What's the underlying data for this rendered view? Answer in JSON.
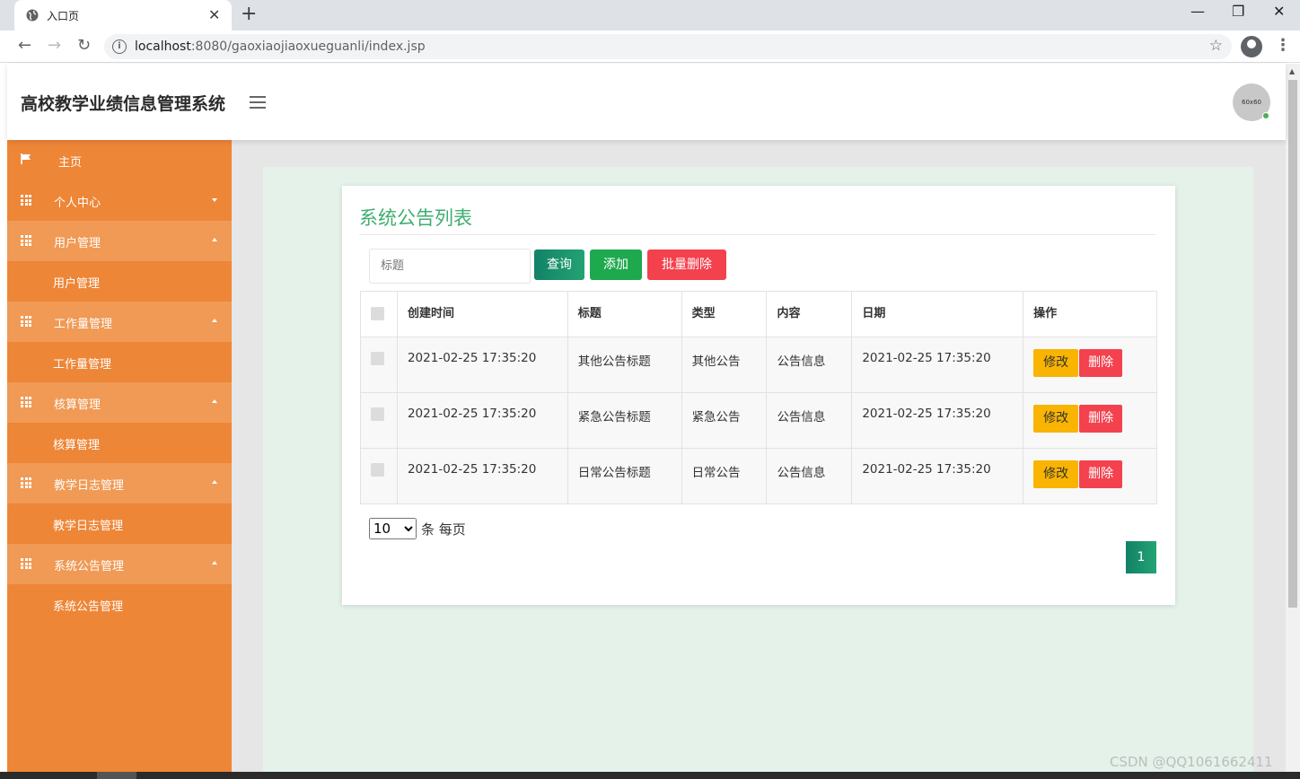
{
  "browser": {
    "tab_title": "入口页",
    "url_host": "localhost",
    "url_rest": ":8080/gaoxiaojiaoxueguanli/index.jsp"
  },
  "header": {
    "title": "高校教学业绩信息管理系统",
    "avatar_text": "60x60"
  },
  "sidebar": {
    "items": [
      {
        "label": "主页",
        "icon": "flag-icon"
      },
      {
        "label": "个人中心",
        "icon": "grid-icon"
      },
      {
        "label": "用户管理",
        "icon": "grid-icon"
      },
      {
        "label": "用户管理"
      },
      {
        "label": "工作量管理",
        "icon": "grid-icon"
      },
      {
        "label": "工作量管理"
      },
      {
        "label": "核算管理",
        "icon": "grid-icon"
      },
      {
        "label": "核算管理"
      },
      {
        "label": "教学日志管理",
        "icon": "grid-icon"
      },
      {
        "label": "教学日志管理"
      },
      {
        "label": "系统公告管理",
        "icon": "grid-icon"
      },
      {
        "label": "系统公告管理"
      }
    ]
  },
  "main": {
    "card_title": "系统公告列表",
    "search_placeholder": "标题",
    "query_label": "查询",
    "add_label": "添加",
    "batch_delete_label": "批量删除",
    "columns": [
      "创建时间",
      "标题",
      "类型",
      "内容",
      "日期",
      "操作"
    ],
    "rows": [
      {
        "created": "2021-02-25 17:35:20",
        "title": "其他公告标题",
        "type": "其他公告",
        "content": "公告信息",
        "date": "2021-02-25 17:35:20"
      },
      {
        "created": "2021-02-25 17:35:20",
        "title": "紧急公告标题",
        "type": "紧急公告",
        "content": "公告信息",
        "date": "2021-02-25 17:35:20"
      },
      {
        "created": "2021-02-25 17:35:20",
        "title": "日常公告标题",
        "type": "日常公告",
        "content": "公告信息",
        "date": "2021-02-25 17:35:20"
      }
    ],
    "edit_label": "修改",
    "delete_label": "删除",
    "page_size": "10",
    "page_size_suffix": "条 每页",
    "current_page": "1"
  },
  "watermark": "CSDN @QQ1061662411",
  "colors": {
    "sidebar": "#ee8637",
    "sidebar_open": "#f09a55",
    "accent_green": "#3fae6f",
    "danger": "#f3424e",
    "warning": "#f8b400"
  }
}
